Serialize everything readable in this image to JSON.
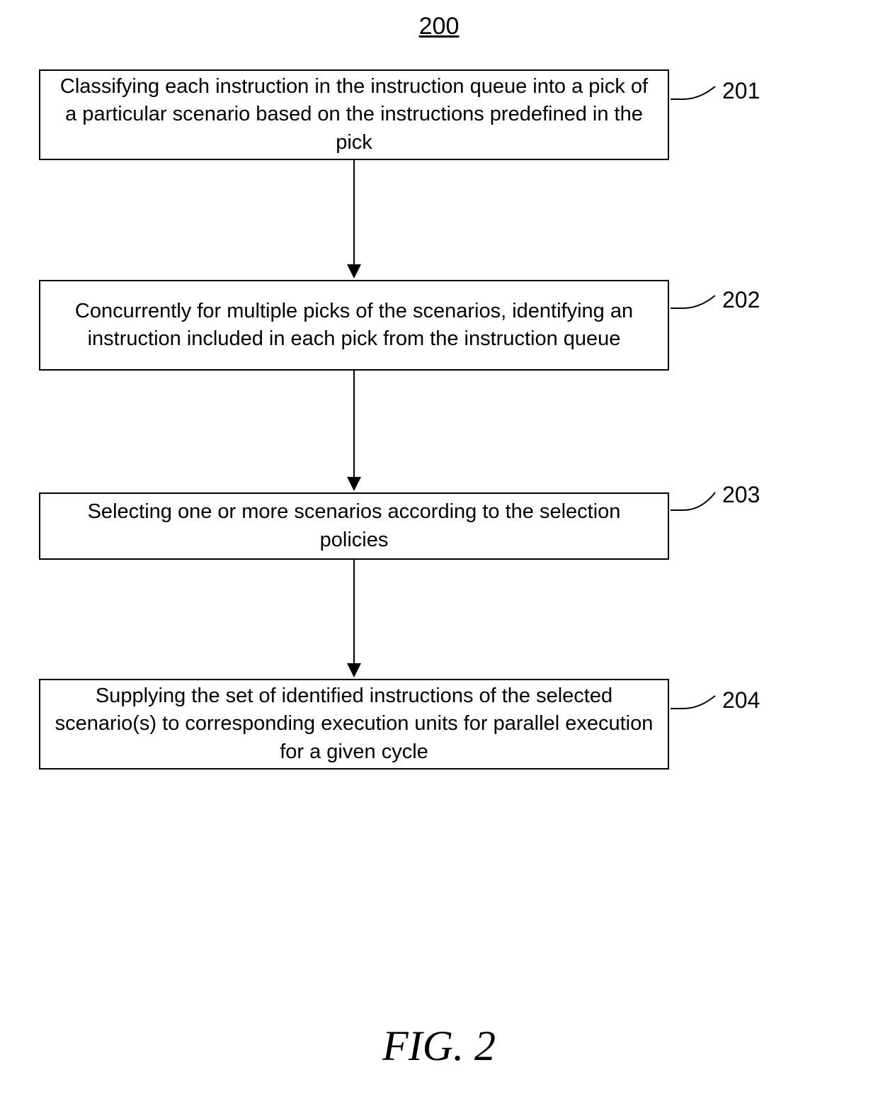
{
  "title": "200",
  "figure_label": "FIG. 2",
  "boxes": [
    {
      "id": "b1",
      "label": "201",
      "text": "Classifying each instruction in the instruction queue into a pick of a particular scenario based on the instructions predefined in the pick"
    },
    {
      "id": "b2",
      "label": "202",
      "text": "Concurrently for multiple picks of the scenarios, identifying an instruction included in each pick from the instruction queue"
    },
    {
      "id": "b3",
      "label": "203",
      "text": "Selecting one or more scenarios according to the selection policies"
    },
    {
      "id": "b4",
      "label": "204",
      "text": "Supplying the set of identified instructions of the selected scenario(s) to corresponding execution units for parallel execution for a given cycle"
    }
  ]
}
